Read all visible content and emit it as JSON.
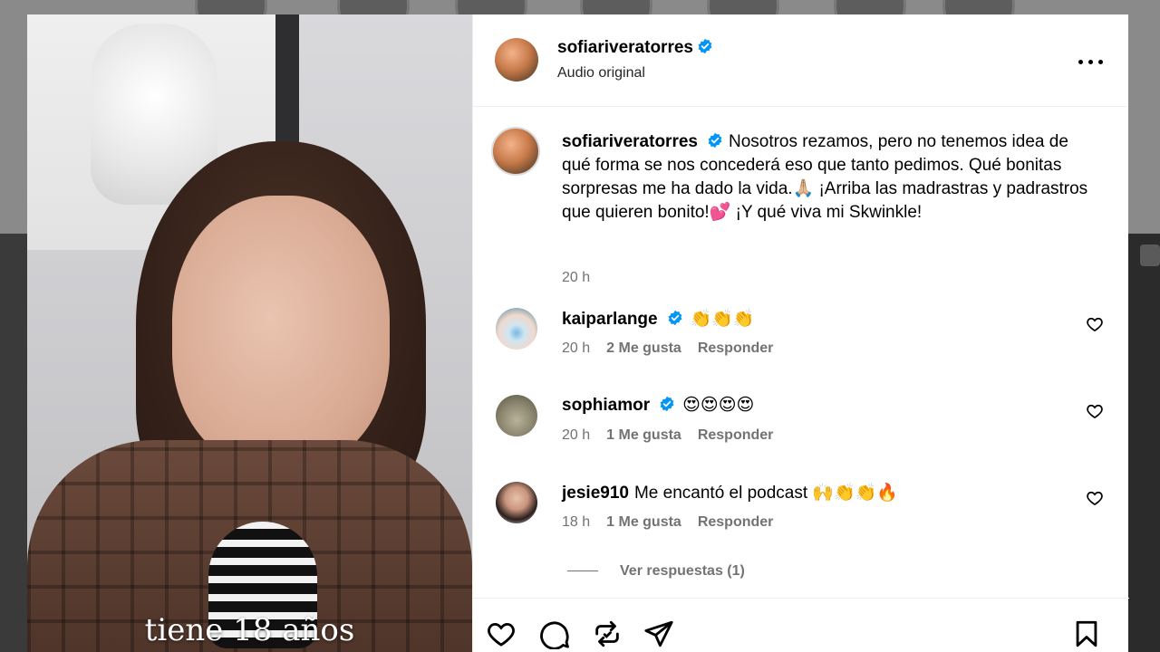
{
  "post": {
    "author": "sofiariveratorres",
    "audio": "Audio original",
    "caption": "Nosotros rezamos, pero no tenemos idea de qué forma se nos concederá eso que tanto pedimos. Qué bonitas sorpresas me ha dado la vida.🙏🏼 ¡Arriba las madrastras y padrastros que quieren bonito!💕 ¡Y qué viva mi Skwinkle!",
    "time": "20 h",
    "subtitle": "tiene 18 años"
  },
  "comments": [
    {
      "user": "kaiparlange",
      "verified": true,
      "text": "👏👏👏",
      "time": "20 h",
      "likes": "2 Me gusta",
      "reply": "Responder"
    },
    {
      "user": "sophiamor",
      "verified": true,
      "text": "😍😍😍😍",
      "time": "20 h",
      "likes": "1 Me gusta",
      "reply": "Responder"
    },
    {
      "user": "jesie910",
      "verified": false,
      "text": "Me encantó el podcast 🙌👏👏🔥",
      "time": "18 h",
      "likes": "1 Me gusta",
      "reply": "Responder"
    }
  ],
  "view_replies": "Ver respuestas (1)",
  "icons": {
    "like": "heart-icon",
    "comment": "comment-icon",
    "share": "repost-icon",
    "send": "send-icon",
    "save": "bookmark-icon",
    "more": "more-icon",
    "verified": "verified-badge-icon"
  },
  "colors": {
    "verified_blue": "#0095f6",
    "secondary_text": "#737373"
  }
}
